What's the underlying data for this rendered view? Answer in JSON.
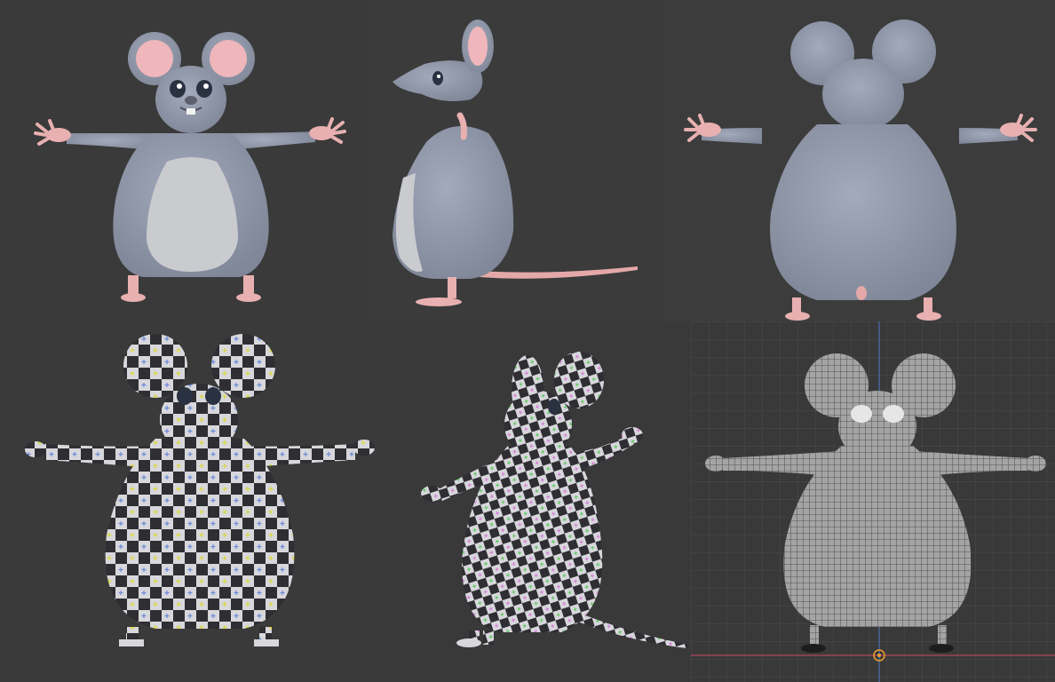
{
  "sheet": {
    "views": [
      {
        "id": "front-shaded"
      },
      {
        "id": "side-shaded"
      },
      {
        "id": "back-shaded"
      },
      {
        "id": "front-uv-checker"
      },
      {
        "id": "three-quarter-uv-checker"
      },
      {
        "id": "front-wireframe"
      }
    ]
  },
  "colors": {
    "background": "#3a3a3a",
    "body_gray": "#8e96a8",
    "belly": "#c9cbcf",
    "skin_pink": "#e8b0b0",
    "ear_inner": "#efb6bb",
    "checker_dark": "#2e2e33",
    "checker_light": "#d7d7dc",
    "wire_fill": "#9b9b9b",
    "grid_line": "#4a4a4a",
    "axis_red": "#b0455a",
    "axis_blue": "#4d6fb0",
    "origin_marker": "#f0a030"
  },
  "icons": {
    "origin": "origin-marker-icon"
  }
}
